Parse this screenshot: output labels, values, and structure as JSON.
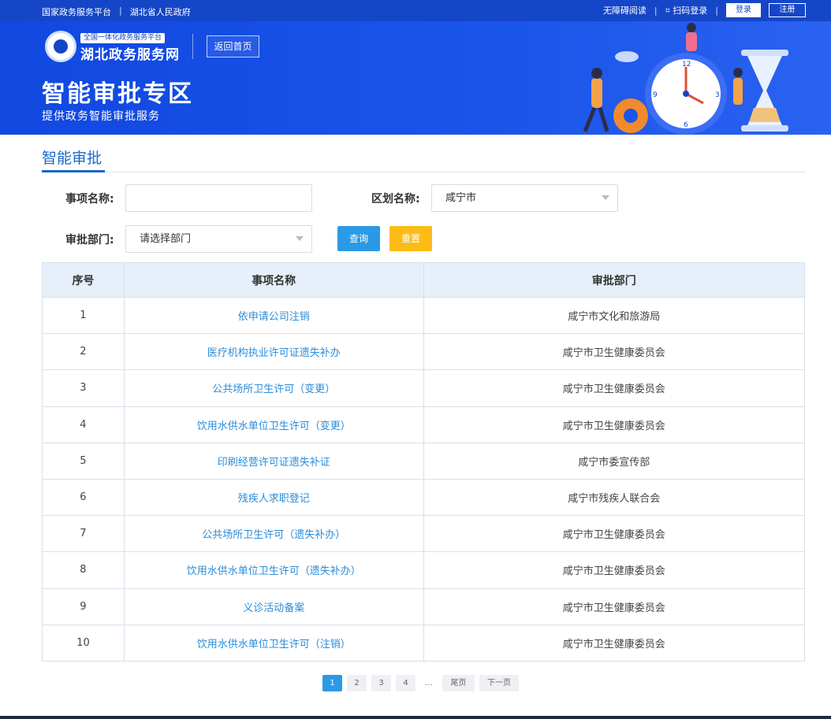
{
  "topbar": {
    "links": [
      "国家政务服务平台",
      "|",
      "湖北省人民政府"
    ],
    "accessibility": "无障碍阅读",
    "scan_login": "扫码登录",
    "login": "登录",
    "register": "注册"
  },
  "banner": {
    "logo_sub": "全国一体化政务服务平台",
    "logo_main": "湖北政务服务网",
    "home_button": "返回首页",
    "title": "智能审批专区",
    "subtitle": "提供政务智能审批服务"
  },
  "section": {
    "title": "智能审批"
  },
  "filters": {
    "item_name_label": "事项名称:",
    "item_name_value": "",
    "region_label": "区划名称:",
    "region_value": "咸宁市",
    "dept_label": "审批部门:",
    "dept_value": "请选择部门",
    "query": "查询",
    "reset": "重置"
  },
  "table": {
    "headers": [
      "序号",
      "事项名称",
      "审批部门"
    ],
    "rows": [
      [
        "1",
        "依申请公司注销",
        "咸宁市文化和旅游局"
      ],
      [
        "2",
        "医疗机构执业许可证遗失补办",
        "咸宁市卫生健康委员会"
      ],
      [
        "3",
        "公共场所卫生许可（变更）",
        "咸宁市卫生健康委员会"
      ],
      [
        "4",
        "饮用水供水单位卫生许可（变更）",
        "咸宁市卫生健康委员会"
      ],
      [
        "5",
        "印刷经营许可证遗失补证",
        "咸宁市委宣传部"
      ],
      [
        "6",
        "残疾人求职登记",
        "咸宁市残疾人联合会"
      ],
      [
        "7",
        "公共场所卫生许可（遗失补办）",
        "咸宁市卫生健康委员会"
      ],
      [
        "8",
        "饮用水供水单位卫生许可（遗失补办）",
        "咸宁市卫生健康委员会"
      ],
      [
        "9",
        "义诊活动备案",
        "咸宁市卫生健康委员会"
      ],
      [
        "10",
        "饮用水供水单位卫生许可（注销）",
        "咸宁市卫生健康委员会"
      ]
    ]
  },
  "pagination": {
    "pages": [
      "1",
      "2",
      "3",
      "4"
    ],
    "current": "1",
    "ellipsis": "...",
    "last": "尾页",
    "next": "下一页"
  },
  "colors": {
    "primary": "#1546c8",
    "link": "#2a8cd9",
    "query": "#2a9ae6",
    "reset": "#fcbb16"
  }
}
